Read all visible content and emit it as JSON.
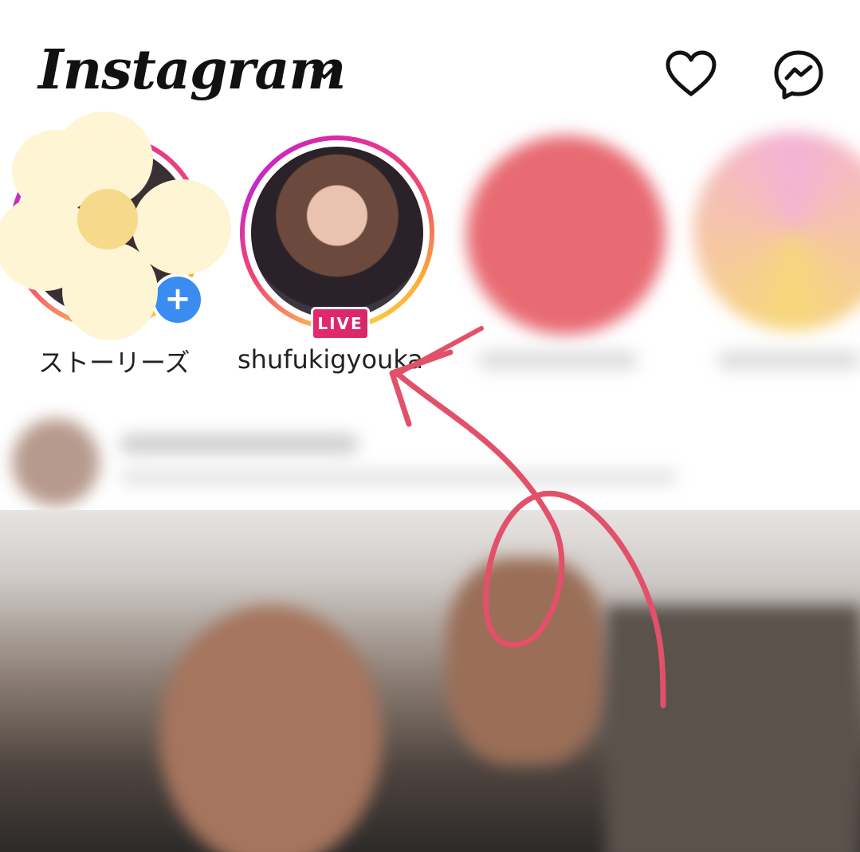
{
  "header": {
    "logo_text": "Instagram",
    "chevron_icon": "chevron-down-icon",
    "heart_icon": "heart-icon",
    "messenger_icon": "messenger-icon"
  },
  "stories": [
    {
      "label": "ストーリーズ",
      "badge": "+",
      "icon": "add-story-icon"
    },
    {
      "label": "shufukigyouka",
      "badge": "LIVE"
    }
  ],
  "colors": {
    "live_badge": "#e4286f",
    "annotation_arrow": "#e2506a",
    "add_badge": "#3b8cf0",
    "flower_petal": "#fdf5d3",
    "flower_center": "#f7d98b"
  }
}
